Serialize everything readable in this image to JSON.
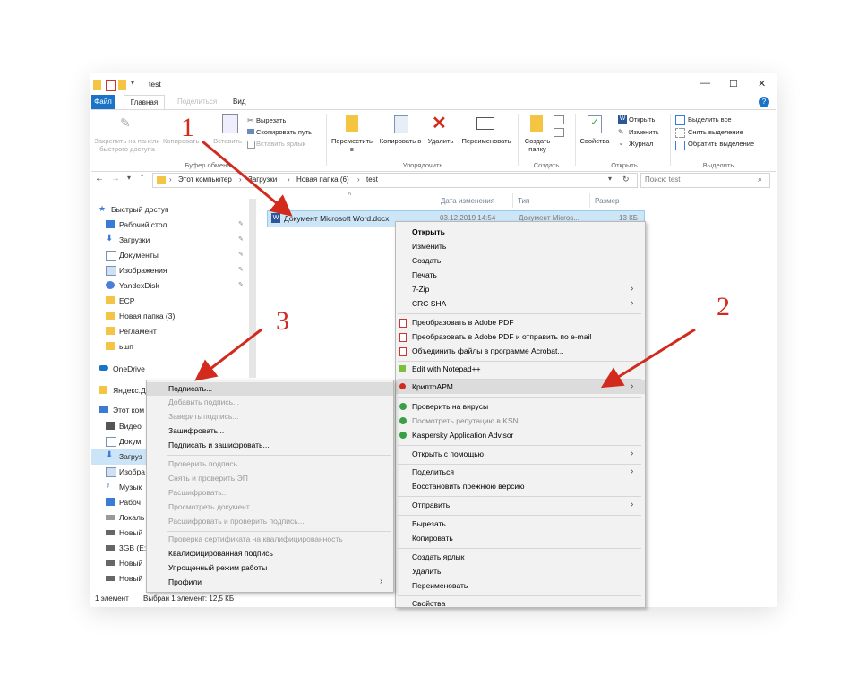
{
  "window": {
    "title": "test",
    "controls": {
      "minimize": "—",
      "maximize": "☐",
      "close": "✕"
    },
    "help": "?"
  },
  "tabs": [
    {
      "label": "Файл"
    },
    {
      "label": "Главная"
    },
    {
      "label": "Поделиться"
    },
    {
      "label": "Вид"
    }
  ],
  "ribbon": {
    "pin_label": "Закрепить на панели быстрого доступа",
    "copy_label": "Копировать",
    "paste_label": "Вставить",
    "cut_label": "Вырезать",
    "copy_path_label": "Скопировать путь",
    "paste_shortcut_label": "Вставить ярлык",
    "group_clipboard": "Буфер обмена",
    "move_label": "Переместить в",
    "copyto_label": "Копировать в",
    "delete_label": "Удалить",
    "rename_label": "Переименовать",
    "group_organize": "Упорядочить",
    "new_folder_label": "Создать папку",
    "group_create": "Создать",
    "props_label": "Свойства",
    "open_label": "Открыть",
    "edit_label": "Изменить",
    "history_label": "Журнал",
    "group_open": "Открыть",
    "select_all_label": "Выделить все",
    "select_none_label": "Снять выделение",
    "invert_label": "Обратить выделение",
    "group_select": "Выделить"
  },
  "address": {
    "path": [
      "Этот компьютер",
      "Загрузки",
      "Новая папка (6)",
      "test"
    ],
    "search_placeholder": "Поиск: test"
  },
  "nav": {
    "quick_access": "Быстрый доступ",
    "items": [
      {
        "label": "Рабочий стол",
        "icon": "desktop-icon"
      },
      {
        "label": "Загрузки",
        "icon": "download-icon"
      },
      {
        "label": "Документы",
        "icon": "documents-icon"
      },
      {
        "label": "Изображения",
        "icon": "pictures-icon"
      },
      {
        "label": "YandexDisk",
        "icon": "yandex-disk-icon"
      },
      {
        "label": "ЕСР",
        "icon": "folder-icon"
      },
      {
        "label": "Новая папка (3)",
        "icon": "folder-icon"
      },
      {
        "label": "Регламент",
        "icon": "folder-icon"
      },
      {
        "label": "ьшп",
        "icon": "folder-icon"
      }
    ],
    "onedrive": "OneDrive",
    "yandex": "Яндекс.Д",
    "this_pc": "Этот ком",
    "pc_items": [
      "Видео",
      "Докум",
      "Загруз",
      "Изобра",
      "Музык",
      "Рабоч",
      "Локаль",
      "Новый",
      "3GB (E:)",
      "Новый",
      "Новый"
    ]
  },
  "columns": {
    "date": "Дата изменения",
    "type": "Тип",
    "size": "Размер"
  },
  "file": {
    "name": "Документ Microsoft Word.docx",
    "date": "03.12.2019 14:54",
    "type": "Документ Micros...",
    "size": "13 КБ"
  },
  "context_menu": {
    "items": [
      "Открыть",
      "Изменить",
      "Создать",
      "Печать",
      "7-Zip",
      "CRC SHA",
      "Преобразовать в Adobe PDF",
      "Преобразовать в Adobe PDF и отправить по e-mail",
      "Объединить файлы в программе Acrobat...",
      "Edit with Notepad++",
      "КриптоАРМ",
      "Проверить на вирусы",
      "Посмотреть репутацию в KSN",
      "Kaspersky Application Advisor",
      "Открыть с помощью",
      "Поделиться",
      "Восстановить прежнюю версию",
      "Отправить",
      "Вырезать",
      "Копировать",
      "Создать ярлык",
      "Удалить",
      "Переименовать",
      "Свойства"
    ],
    "arrow": "›"
  },
  "submenu": {
    "items": [
      "Подписать...",
      "Добавить подпись...",
      "Заверить подпись...",
      "Зашифровать...",
      "Подписать и зашифровать...",
      "Проверить подпись...",
      "Снять и проверить ЭП",
      "Расшифровать...",
      "Просмотреть документ...",
      "Расшифровать и проверить подпись...",
      "Проверка сертификата на квалифицированность",
      "Квалифицированная подпись",
      "Упрощенный режим работы",
      "Профили"
    ]
  },
  "status": {
    "count": "1 элемент",
    "selected": "Выбран 1 элемент: 12,5 КБ"
  },
  "annotations": {
    "n1": "1",
    "n2": "2",
    "n3": "3"
  },
  "colors": {
    "accent": "#1a73c7",
    "arrow_red": "#d32a1e",
    "folder": "#f4c542",
    "selection": "#cde6f7"
  }
}
